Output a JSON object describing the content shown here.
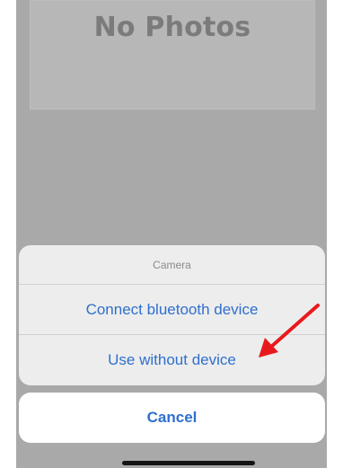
{
  "background": {
    "empty_state_title": "No Photos"
  },
  "action_sheet": {
    "title": "Camera",
    "actions": [
      {
        "label": "Connect bluetooth device"
      },
      {
        "label": "Use without device"
      }
    ],
    "cancel_label": "Cancel"
  },
  "annotation": {
    "arrow_color": "#e8191c",
    "points_to": "Use without device"
  },
  "colors": {
    "action_text": "#2f6fce",
    "dim_overlay": "#a9a9a9"
  }
}
